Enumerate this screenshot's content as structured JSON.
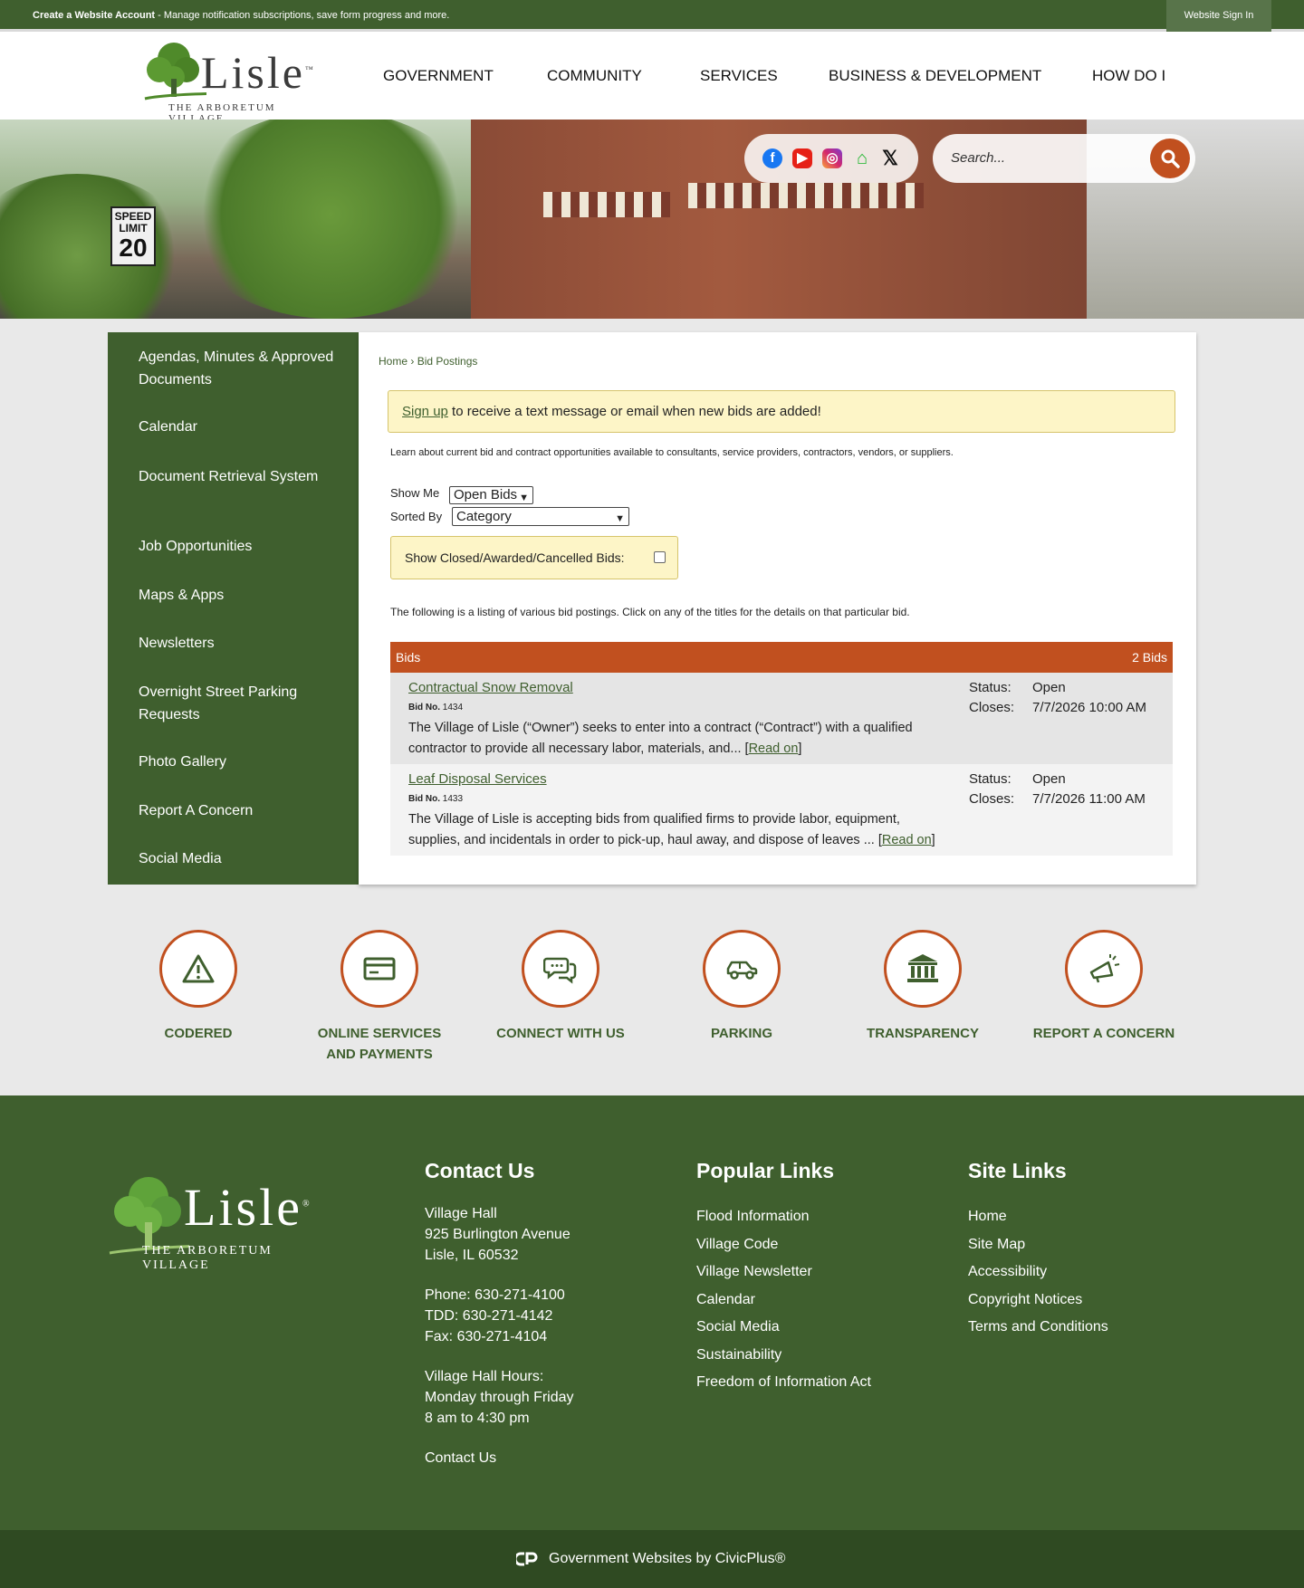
{
  "topbar": {
    "account_bold": "Create a Website Account",
    "account_rest": " - Manage notification subscriptions, save form progress and more.",
    "signin": "Website Sign In"
  },
  "header": {
    "logo_word": "Lisle",
    "logo_tm": "™",
    "logo_sub": "THE ARBORETUM VILLAGE",
    "nav": [
      "GOVERNMENT",
      "COMMUNITY",
      "SERVICES",
      "BUSINESS & DEVELOPMENT",
      "HOW DO I"
    ]
  },
  "hero": {
    "sign_top": "SPEED LIMIT",
    "sign_num": "20",
    "social": [
      "facebook-icon",
      "youtube-icon",
      "instagram-icon",
      "nextdoor-icon",
      "x-icon"
    ],
    "search_placeholder": "Search..."
  },
  "sidebar": {
    "items": [
      "Agendas, Minutes & Approved Documents",
      "Calendar",
      "Document Retrieval System",
      "Job Opportunities",
      "Maps & Apps",
      "Newsletters",
      "Overnight Street Parking Requests",
      "Photo Gallery",
      "Report A Concern",
      "Social Media"
    ]
  },
  "content": {
    "crumb_home": "Home",
    "crumb_sep": " › ",
    "crumb_current": "Bid Postings",
    "alert_link": "Sign up",
    "alert_rest": " to receive a text message or email when new bids are added!",
    "intro": "Learn about current bid and contract opportunities available to consultants, service providers, contractors, vendors, or suppliers.",
    "show_me_label": "Show Me",
    "show_me_value": "Open Bids",
    "sorted_by_label": "Sorted By",
    "sorted_by_value": "Category",
    "closed_label": "Show Closed/Awarded/Cancelled Bids:",
    "listing": "The following is a listing of various bid postings. Click on any of the titles for the details on that particular bid.",
    "bids_header": "Bids",
    "bids_count": "2 Bids",
    "bids": [
      {
        "title": "Contractual Snow Removal",
        "no_label": "Bid No.",
        "no": "1434",
        "desc": "The Village of Lisle (“Owner”) seeks to enter into a contract (“Contract”) with a qualified contractor to provide all necessary labor, materials, and... [",
        "read_on": "Read on",
        "desc_end": "]",
        "status_label": "Status:",
        "status": "Open",
        "closes_label": "Closes:",
        "closes": "7/7/2026 10:00 AM"
      },
      {
        "title": "Leaf Disposal Services",
        "no_label": "Bid No.",
        "no": "1433",
        "desc": "The Village of Lisle is accepting bids from qualified firms to provide labor, equipment, supplies, and incidentals in order to pick-up, haul away, and dispose of leaves ... [",
        "read_on": "Read on",
        "desc_end": "]",
        "status_label": "Status:",
        "status": "Open",
        "closes_label": "Closes:",
        "closes": "7/7/2026 11:00 AM"
      }
    ]
  },
  "quicklinks": [
    {
      "label": "CODERED",
      "icon": "warning-icon"
    },
    {
      "label": "ONLINE SERVICES AND PAYMENTS",
      "icon": "credit-card-icon"
    },
    {
      "label": "CONNECT WITH US",
      "icon": "chat-bubbles-icon"
    },
    {
      "label": "PARKING",
      "icon": "car-icon"
    },
    {
      "label": "TRANSPARENCY",
      "icon": "government-building-icon"
    },
    {
      "label": "REPORT A CONCERN",
      "icon": "megaphone-icon"
    }
  ],
  "footer": {
    "logo_word": "Lisle",
    "logo_tm": "®",
    "logo_sub": "THE ARBORETUM VILLAGE",
    "contact_title": "Contact Us",
    "address": [
      "Village Hall",
      "925 Burlington Avenue",
      "Lisle, IL 60532"
    ],
    "phones": [
      "Phone: 630-271-4100",
      "TDD: 630-271-4142",
      "Fax: 630-271-4104"
    ],
    "hours": [
      "Village Hall Hours:",
      "Monday through Friday",
      "8 am to 4:30 pm"
    ],
    "contact_link": "Contact Us",
    "popular_title": "Popular Links",
    "popular": [
      "Flood Information",
      "Village Code",
      "Village Newsletter",
      "Calendar",
      "Social Media",
      "Sustainability",
      "Freedom of Information Act"
    ],
    "site_title": "Site Links",
    "site": [
      "Home",
      "Site Map",
      "Accessibility",
      "Copyright Notices",
      "Terms and Conditions"
    ],
    "bottom": "Government Websites by CivicPlus®"
  },
  "colors": {
    "green": "#3f5f2e",
    "orange": "#c1501f",
    "alert_bg": "#fdf5c7"
  }
}
